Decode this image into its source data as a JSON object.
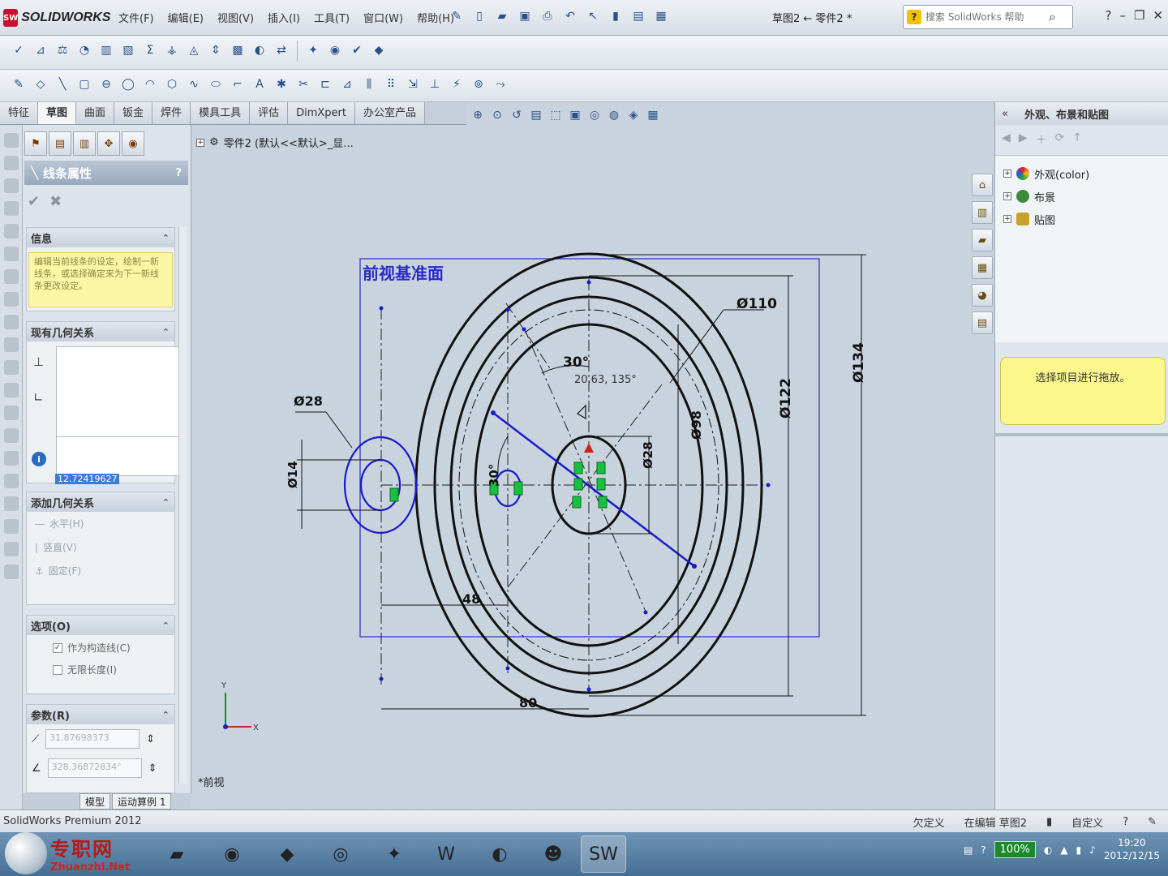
{
  "app": {
    "logo_text": "SOLIDWORKS",
    "menus": [
      "文件(F)",
      "编辑(E)",
      "视图(V)",
      "插入(I)",
      "工具(T)",
      "窗口(W)",
      "帮助(H)"
    ],
    "doc_title": "草图2 ← 零件2 *",
    "search_placeholder": "搜索 SolidWorks 帮助"
  },
  "command_tabs": [
    "特征",
    "草图",
    "曲面",
    "钣金",
    "焊件",
    "模具工具",
    "评估",
    "DimXpert",
    "办公室产品"
  ],
  "active_tab": "草图",
  "property_manager": {
    "title": "线条属性",
    "help": "?",
    "info": {
      "heading": "信息",
      "message": "编辑当前线条的设定，绘制一新线条，或选择确定来为下一新线条更改设定。"
    },
    "existing_relations": {
      "heading": "现有几何关系"
    },
    "length_value": "12.72419627",
    "add_relations": {
      "heading": "添加几何关系",
      "items": [
        "水平(H)",
        "竖直(V)",
        "固定(F)"
      ]
    },
    "options": {
      "heading": "选项(O)",
      "items": [
        {
          "label": "作为构造线(C)",
          "checked": true
        },
        {
          "label": "无限长度(I)",
          "checked": false
        }
      ]
    },
    "parameters": {
      "heading": "参数(R)",
      "p1": "31.87698373",
      "p2": "328.36872834°"
    }
  },
  "bottom_tabs": [
    "模型",
    "运动算例 1"
  ],
  "graphics": {
    "tree_text": "零件2 (默认<<默认>_显...",
    "view_label": "*前视",
    "plane_label": "前视基准面",
    "dims": {
      "d110": "Ø110",
      "d134": "Ø134",
      "d122": "Ø122",
      "d98": "Ø98",
      "d28_center": "Ø28",
      "d28_left": "Ø28",
      "d14": "Ø14",
      "angle_top": "30°",
      "angle_side": "30°",
      "cursor_readout": "20.63, 135°",
      "dim48": "48",
      "dim80": "80"
    },
    "axis_labels": {
      "x": "X",
      "y": "Y"
    }
  },
  "task_pane": {
    "title": "外观、布景和贴图",
    "items": [
      "外观(color)",
      "布景",
      "贴图"
    ],
    "note": "选择项目进行拖放。"
  },
  "status_bar": {
    "left": "SolidWorks Premium 2012",
    "defined": "欠定义",
    "editing": "在编辑 草图2",
    "custom": "自定义"
  },
  "taskbar": {
    "zoom": "100%",
    "time": "19:20",
    "date": "2012/12/15"
  },
  "watermark": {
    "cn": "专职网",
    "en": "Zhuanzhi.Net"
  },
  "colors": {
    "sketch_black": "#111111",
    "sketch_blue": "#1a1ad0",
    "relation_green": "#18c040",
    "pm_header": "#98a9bd",
    "note_yellow": "#fbf78a"
  }
}
